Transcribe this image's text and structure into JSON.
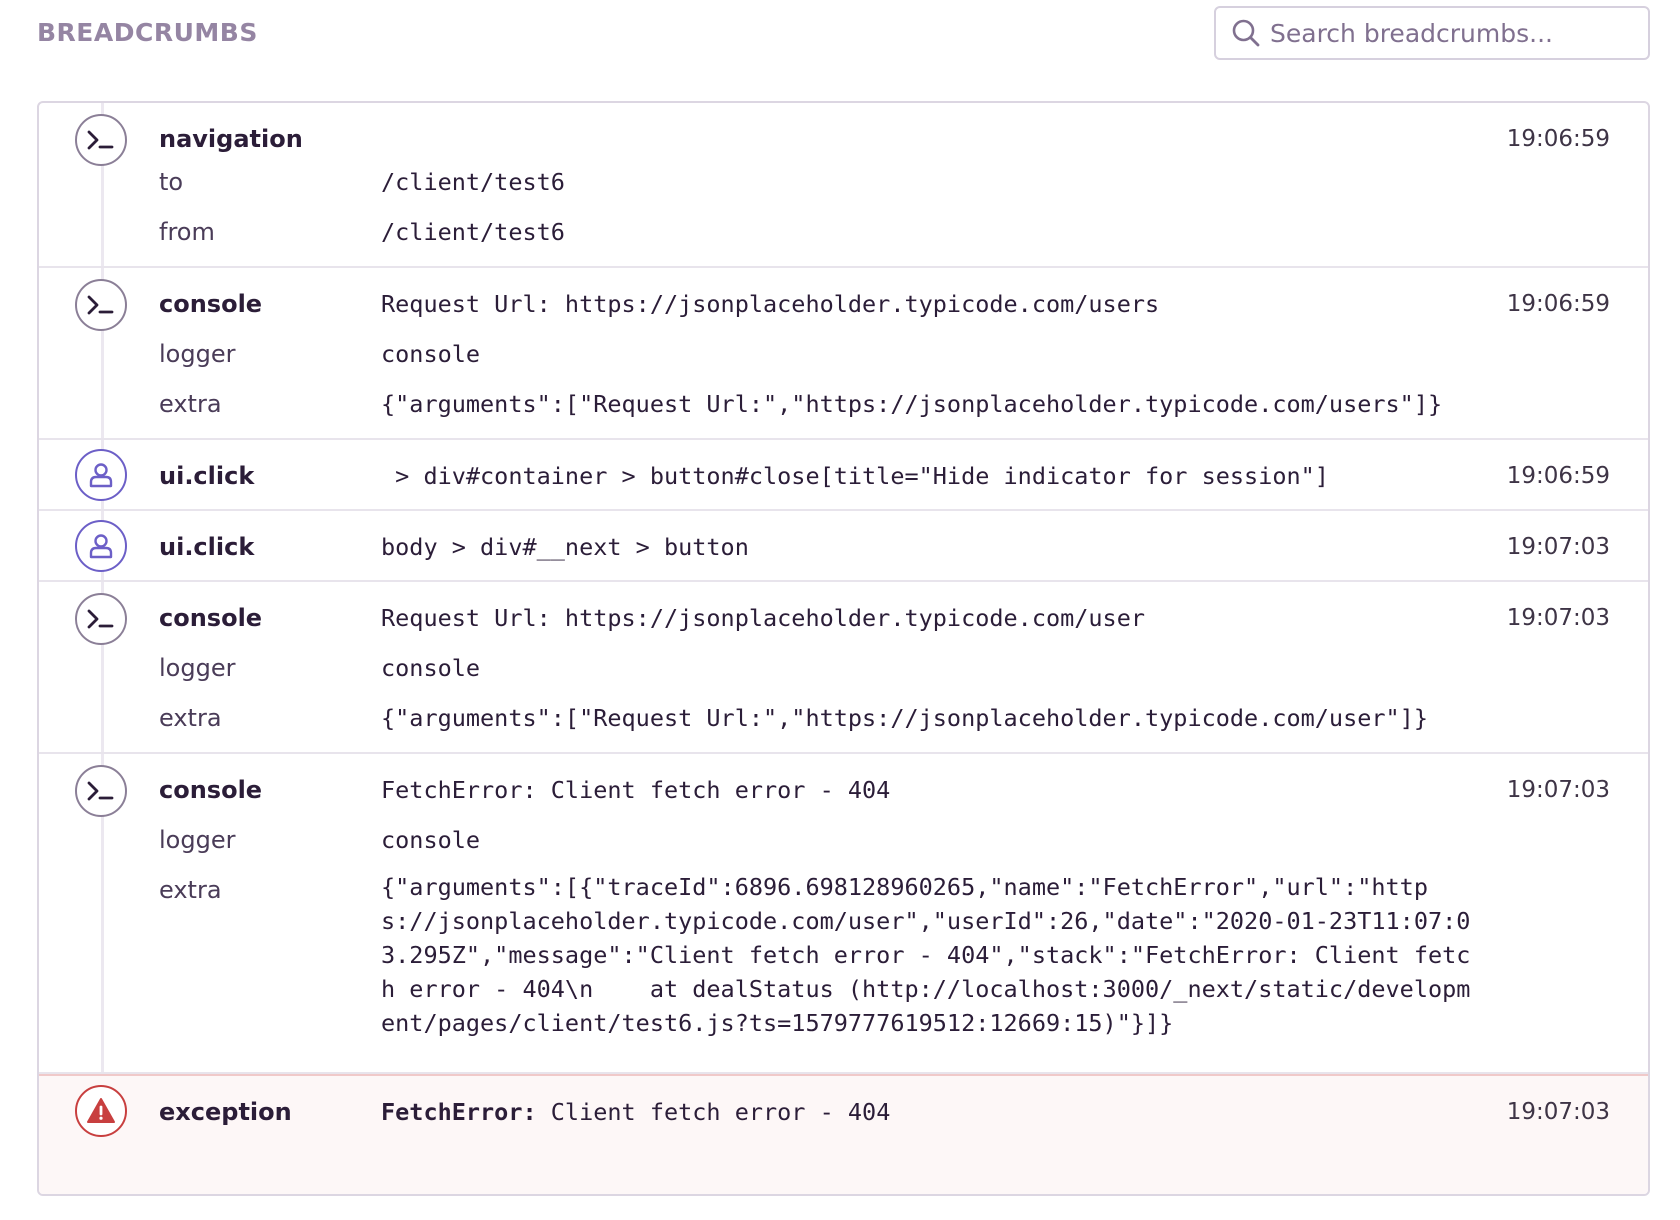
{
  "header": {
    "title": "BREADCRUMBS",
    "search_placeholder": "Search breadcrumbs..."
  },
  "crumbs": [
    {
      "type": "navigation",
      "icon": "terminal-icon",
      "time": "19:06:59",
      "to_label": "to",
      "to_value": "/client/test6",
      "from_label": "from",
      "from_value": "/client/test6"
    },
    {
      "type": "console",
      "icon": "terminal-icon",
      "time": "19:06:59",
      "message": "Request Url: https://jsonplaceholder.typicode.com/users",
      "logger_label": "logger",
      "logger_value": "console",
      "extra_label": "extra",
      "extra_value": "{\"arguments\":[\"Request Url:\",\"https://jsonplaceholder.typicode.com/users\"]}"
    },
    {
      "type": "ui.click",
      "icon": "user-icon",
      "time": "19:06:59",
      "message": " > div#container > button#close[title=\"Hide indicator for session\"]"
    },
    {
      "type": "ui.click",
      "icon": "user-icon",
      "time": "19:07:03",
      "message": "body > div#__next > button"
    },
    {
      "type": "console",
      "icon": "terminal-icon",
      "time": "19:07:03",
      "message": "Request Url: https://jsonplaceholder.typicode.com/user",
      "logger_label": "logger",
      "logger_value": "console",
      "extra_label": "extra",
      "extra_value": "{\"arguments\":[\"Request Url:\",\"https://jsonplaceholder.typicode.com/user\"]}"
    },
    {
      "type": "console",
      "icon": "terminal-icon",
      "time": "19:07:03",
      "message": "FetchError: Client fetch error - 404",
      "logger_label": "logger",
      "logger_value": "console",
      "extra_label": "extra",
      "extra_value": "{\"arguments\":[{\"traceId\":6896.698128960265,\"name\":\"FetchError\",\"url\":\"https://jsonplaceholder.typicode.com/user\",\"userId\":26,\"date\":\"2020-01-23T11:07:03.295Z\",\"message\":\"Client fetch error - 404\",\"stack\":\"FetchError: Client fetch error - 404\\n    at dealStatus (http://localhost:3000/_next/static/development/pages/client/test6.js?ts=1579777619512:12669:15)\"}]}"
    },
    {
      "type": "exception",
      "icon": "warning-icon",
      "time": "19:07:03",
      "error_type": "FetchError:",
      "message": " Client fetch error - 404"
    }
  ],
  "colors": {
    "accent": "#6c5fc7",
    "error": "#c83f3f",
    "muted": "#9585a3"
  }
}
